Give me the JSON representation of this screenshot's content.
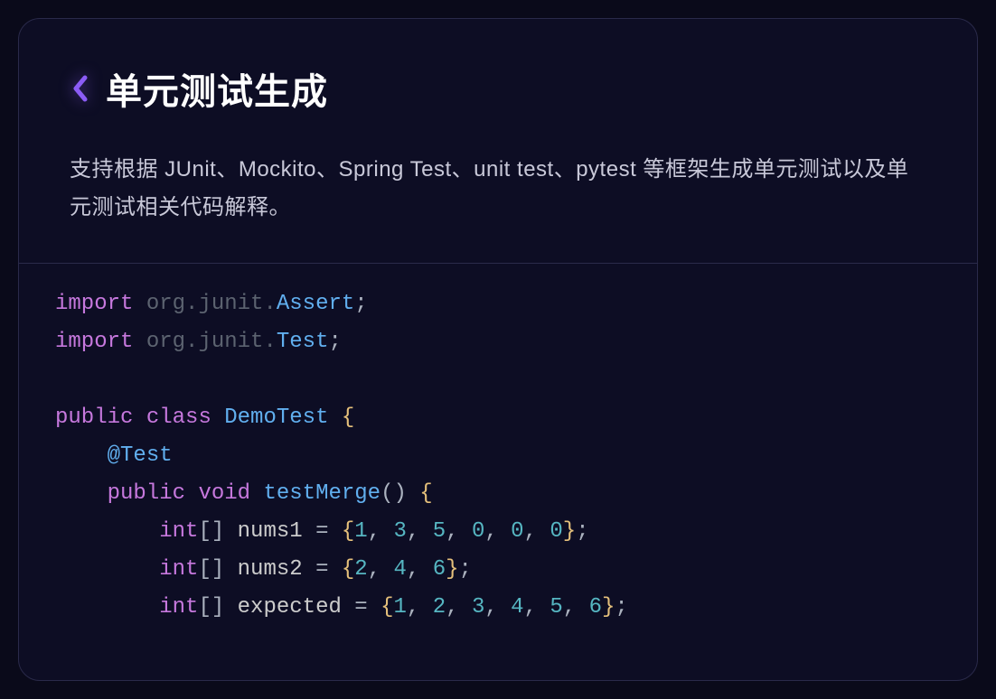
{
  "header": {
    "title": "单元测试生成",
    "description": "支持根据 JUnit、Mockito、Spring Test、unit test、pytest 等框架生成单元测试以及单元测试相关代码解释。"
  },
  "code": {
    "import_kw": "import",
    "pkg1": "org.junit.",
    "cls1": "Assert",
    "pkg2": "org.junit.",
    "cls2": "Test",
    "public_kw": "public",
    "class_kw": "class",
    "class_name": "DemoTest",
    "annotation": "@Test",
    "void_kw": "void",
    "method_name": "testMerge",
    "int_kw": "int",
    "var1": "nums1",
    "var2": "nums2",
    "var3": "expected",
    "arr1": {
      "v0": "1",
      "v1": "3",
      "v2": "5",
      "v3": "0",
      "v4": "0",
      "v5": "0"
    },
    "arr2": {
      "v0": "2",
      "v1": "4",
      "v2": "6"
    },
    "arr3": {
      "v0": "1",
      "v1": "2",
      "v2": "3",
      "v3": "4",
      "v4": "5",
      "v5": "6"
    },
    "semi": ";",
    "comma": ",",
    "sp": " ",
    "lbrace": "{",
    "rbrace": "}",
    "lparen": "(",
    "rparen": ")",
    "lbracket": "[",
    "rbracket": "]",
    "eq": "="
  }
}
